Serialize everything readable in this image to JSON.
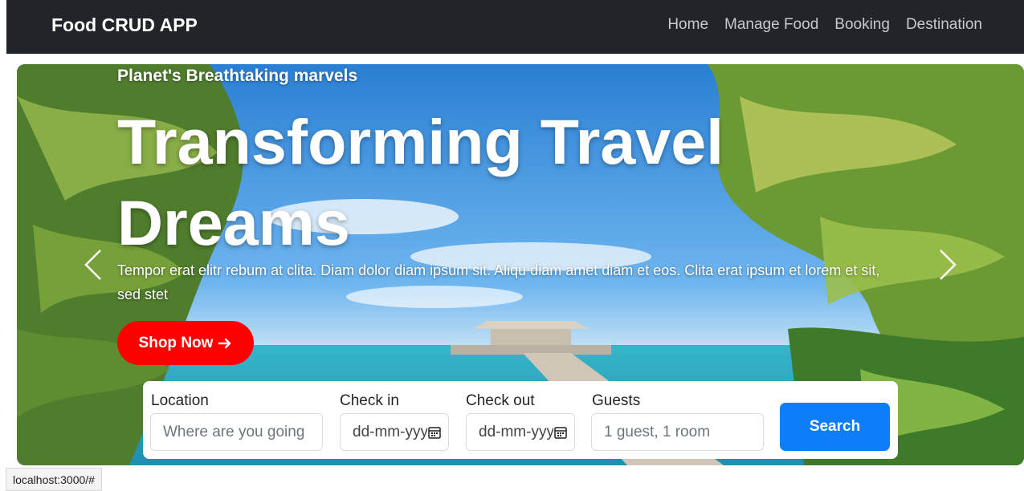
{
  "navbar": {
    "brand": "Food CRUD APP",
    "links": [
      "Home",
      "Manage Food",
      "Booking",
      "Destination"
    ]
  },
  "hero": {
    "subtitle": "Planet's Breathtaking marvels",
    "title_line1": "Transforming Travel",
    "title_line2": "Dreams",
    "description": "Tempor erat elitr rebum at clita. Diam dolor diam ipsum sit. Aliqu diam amet diam et eos. Clita erat ipsum et lorem et sit, sed stet",
    "cta_label": "Shop Now",
    "cta_icon": "arrow-right-icon",
    "prev_icon": "chevron-left-icon",
    "next_icon": "chevron-right-icon"
  },
  "search": {
    "location_label": "Location",
    "location_placeholder": "Where are you going",
    "checkin_label": "Check in",
    "checkin_value": "dd-mm-yyyy",
    "checkout_label": "Check out",
    "checkout_value": "dd-mm-yyyy",
    "guests_label": "Guests",
    "guests_placeholder": "1 guest, 1 room",
    "button_label": "Search"
  },
  "status_bar": {
    "url": "localhost:3000/#"
  },
  "colors": {
    "navbar_bg": "#212529",
    "cta_bg": "#ff0000",
    "search_button_bg": "#0d7dfa"
  }
}
